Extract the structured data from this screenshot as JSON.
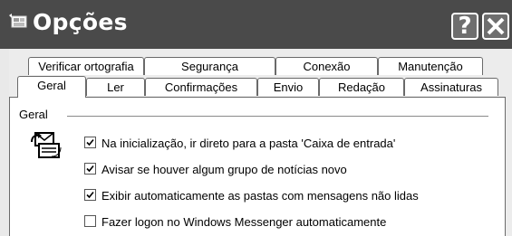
{
  "window": {
    "title": "Opções",
    "title_icon": "newspaper-icon",
    "help_button": "?",
    "close_icon": "close-icon"
  },
  "tabs": {
    "row1": [
      {
        "label": "Verificar ortografia"
      },
      {
        "label": "Segurança"
      },
      {
        "label": "Conexão"
      },
      {
        "label": "Manutenção"
      }
    ],
    "row2": [
      {
        "label": "Geral",
        "active": true
      },
      {
        "label": "Ler"
      },
      {
        "label": "Confirmações"
      },
      {
        "label": "Envio"
      },
      {
        "label": "Redação"
      },
      {
        "label": "Assinaturas"
      }
    ]
  },
  "general": {
    "group_label": "Geral",
    "group_icon": "mail-send-receive-icon",
    "options": [
      {
        "label": "Na inicialização, ir direto para a pasta 'Caixa de entrada'",
        "checked": true
      },
      {
        "label": "Avisar se houver algum grupo de notícias novo",
        "checked": true
      },
      {
        "label": "Exibir automaticamente as pastas com mensagens não lidas",
        "checked": true
      },
      {
        "label": "Fazer logon no Windows Messenger automaticamente",
        "checked": false
      }
    ]
  }
}
